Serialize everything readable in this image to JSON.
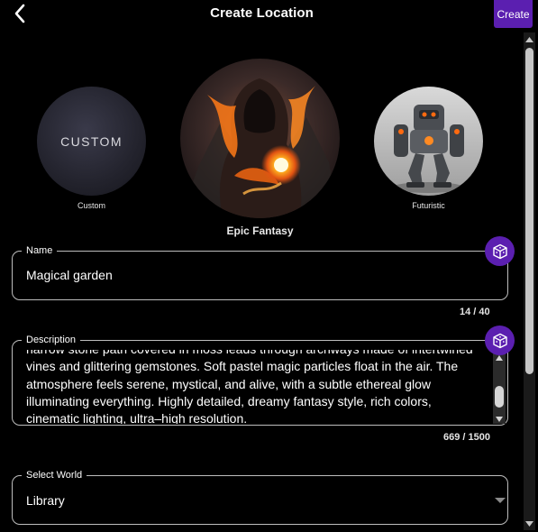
{
  "header": {
    "title": "Create Location",
    "create_label": "Create",
    "back_icon": "chevron-left-icon"
  },
  "styles": {
    "custom_text": "CUSTOM",
    "custom_label": "Custom",
    "featured_label": "Epic Fantasy",
    "futuristic_label": "Futuristic",
    "selected": "Epic Fantasy"
  },
  "name_field": {
    "label": "Name",
    "value": "Magical garden",
    "counter": "14 / 40"
  },
  "description_field": {
    "label": "Description",
    "value": "narrow stone path covered in moss leads through archways made of intertwined vines and glittering gemstones. Soft pastel magic particles float in the air. The atmosphere feels serene, mystical, and alive, with a subtle ethereal glow illuminating everything. Highly detailed, dreamy fantasy style, rich colors, cinematic lighting, ultra–high resolution.",
    "counter": "669 / 1500"
  },
  "world_select": {
    "label": "Select World",
    "value": "Library"
  },
  "colors": {
    "accent": "#5b1fb0",
    "background": "#000000",
    "border": "#bdbdbd"
  }
}
